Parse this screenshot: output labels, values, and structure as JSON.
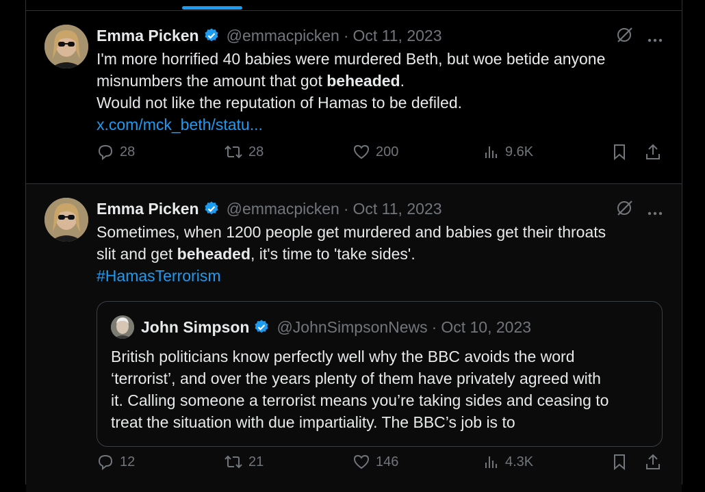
{
  "tweets": [
    {
      "author": "Emma Picken",
      "handle": "@emmacpicken",
      "sep": "·",
      "date": "Oct 11, 2023",
      "line1": "I'm more horrified 40 babies were murdered Beth, but woe betide anyone",
      "line2_pre": "misnumbers the amount that got ",
      "line2_bold": "beheaded",
      "line2_post": ".",
      "line3": "Would not like the reputation of Hamas to be defiled.",
      "link": "x.com/mck_beth/statu...",
      "replies": "28",
      "reposts": "28",
      "likes": "200",
      "views": "9.6K"
    },
    {
      "author": "Emma Picken",
      "handle": "@emmacpicken",
      "sep": "·",
      "date": "Oct 11, 2023",
      "line1": "Sometimes, when 1200 people get murdered and babies get their throats",
      "line2_pre": "slit and get ",
      "line2_bold": "beheaded",
      "line2_post": ", it's time to 'take sides'.",
      "hashtag": "#HamasTerrorism",
      "replies": "12",
      "reposts": "21",
      "likes": "146",
      "views": "4.3K",
      "quote": {
        "author": "John Simpson",
        "handle": "@JohnSimpsonNews",
        "sep": "·",
        "date": "Oct 10, 2023",
        "lines": [
          "British politicians know perfectly well why the BBC avoids the word",
          "‘terrorist’, and over the years plenty of them have privately agreed with",
          "it.  Calling someone a terrorist means you’re taking sides and ceasing to",
          "treat the situation with due impartiality.  The BBC’s job is to"
        ]
      }
    }
  ],
  "colors": {
    "background": "#000000",
    "text": "#e7e9ea",
    "muted": "#71767b",
    "accent": "#1d9bf0",
    "border": "#2f3336"
  },
  "icons": [
    "verified-badge-icon",
    "grok-icon",
    "more-icon",
    "reply-icon",
    "repost-icon",
    "like-icon",
    "views-icon",
    "bookmark-icon",
    "share-icon"
  ]
}
